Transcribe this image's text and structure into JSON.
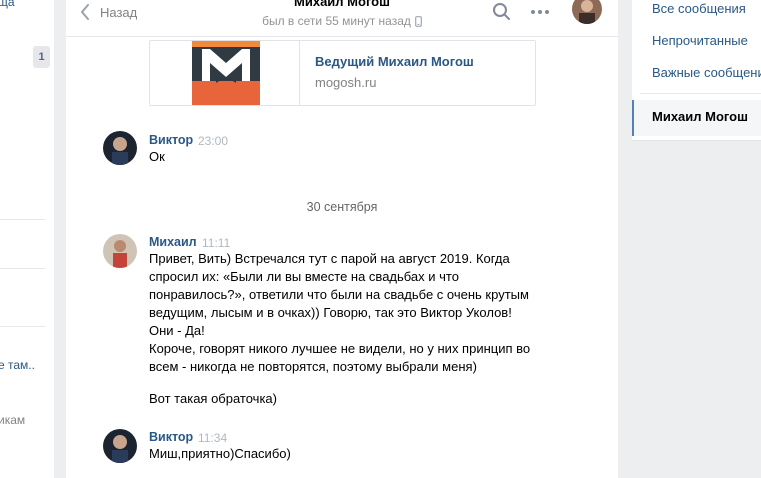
{
  "left_fragments": {
    "top_text": "ща",
    "badge": "1",
    "mid_text": "е там..",
    "bottom_text": "икам"
  },
  "header": {
    "back_label": "Назад",
    "title": "Михаил Могош",
    "status": "был в сети 55 минут назад"
  },
  "link_card": {
    "title": "Ведущий Михаил Могош",
    "domain": "mogosh.ru"
  },
  "messages": [
    {
      "author": "Виктор",
      "time": "23:00",
      "lines": [
        "Ок"
      ]
    },
    {
      "author": "Михаил",
      "time": "11:11",
      "lines": [
        "Привет, Вить) Встречался тут с парой на август 2019. Когда",
        "спросил их: «Были ли вы вместе на свадьбах и что",
        "понравилось?», ответили что были на свадьбе с очень крутым",
        "ведущим, лысым и в очках)) Говорю, так это Виктор Уколов!",
        "Они - Да!",
        "Короче, говорят никого лучшее не видели, но у них принцип во",
        "всем - никогда не повторятся, поэтому выбрали меня)",
        "Вот такая обраточка)"
      ]
    },
    {
      "author": "Виктор",
      "time": "11:34",
      "lines": [
        "Миш,приятно)Спасибо)"
      ]
    }
  ],
  "date_separator": "30 сентября",
  "right_nav": {
    "items": [
      "Все сообщения",
      "Непрочитанные",
      "Важные сообщения"
    ],
    "active": "Михаил Могош"
  },
  "colors": {
    "link": "#2a5885",
    "background": "#edeef0",
    "accent": "#5181b8"
  },
  "icons": {
    "back": "chevron-left-icon",
    "search": "search-icon",
    "more": "more-dots-icon",
    "mobile": "mobile-phone-icon"
  }
}
